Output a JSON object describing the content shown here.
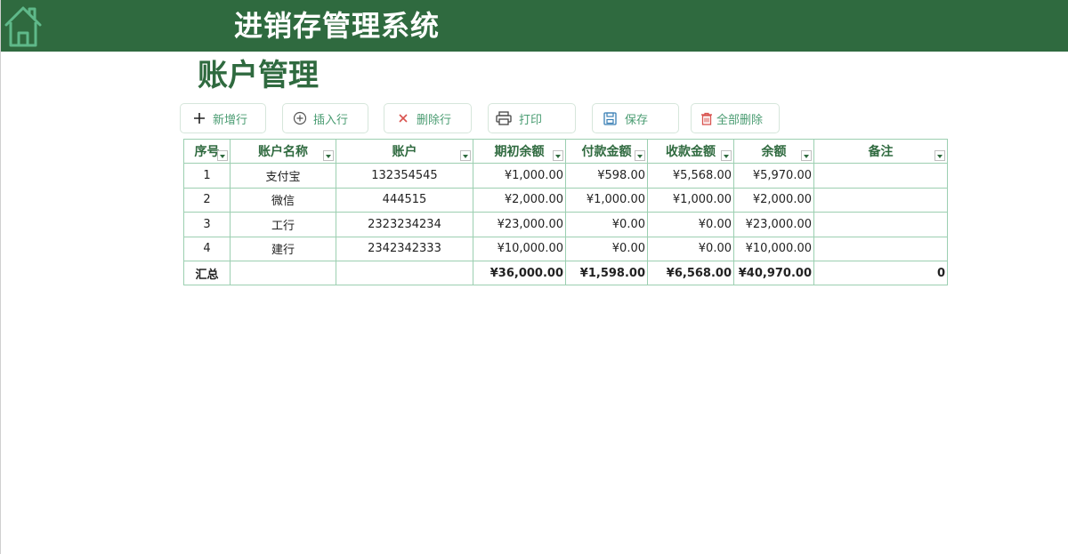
{
  "header": {
    "title": "进销存管理系统"
  },
  "page": {
    "title": "账户管理"
  },
  "toolbar": {
    "add_row": "新增行",
    "insert_row": "插入行",
    "delete_row": "删除行",
    "print": "打印",
    "save": "保存",
    "delete_all": "全部删除"
  },
  "table": {
    "columns": [
      "序号",
      "账户名称",
      "账户",
      "期初余额",
      "付款金额",
      "收款金额",
      "余额",
      "备注"
    ],
    "rows": [
      [
        "1",
        "支付宝",
        "132354545",
        "¥1,000.00",
        "¥598.00",
        "¥5,568.00",
        "¥5,970.00",
        ""
      ],
      [
        "2",
        "微信",
        "444515",
        "¥2,000.00",
        "¥1,000.00",
        "¥1,000.00",
        "¥2,000.00",
        ""
      ],
      [
        "3",
        "工行",
        "2323234234",
        "¥23,000.00",
        "¥0.00",
        "¥0.00",
        "¥23,000.00",
        ""
      ],
      [
        "4",
        "建行",
        "2342342333",
        "¥10,000.00",
        "¥0.00",
        "¥0.00",
        "¥10,000.00",
        ""
      ]
    ],
    "total": [
      "汇总",
      "",
      "",
      "¥36,000.00",
      "¥1,598.00",
      "¥6,568.00",
      "¥40,970.00",
      "0"
    ]
  },
  "icons": {
    "home": "home-icon",
    "add": "plus-icon",
    "insert": "insert-icon",
    "delete": "close-icon",
    "print": "printer-icon",
    "save": "save-icon",
    "delete_all": "trash-icon",
    "filter": "filter-dropdown-icon"
  },
  "colors": {
    "header_bg": "#2f6a3f",
    "accent": "#4a9c72",
    "grid_border": "#9ccfb1",
    "delete_red": "#d9534f"
  }
}
